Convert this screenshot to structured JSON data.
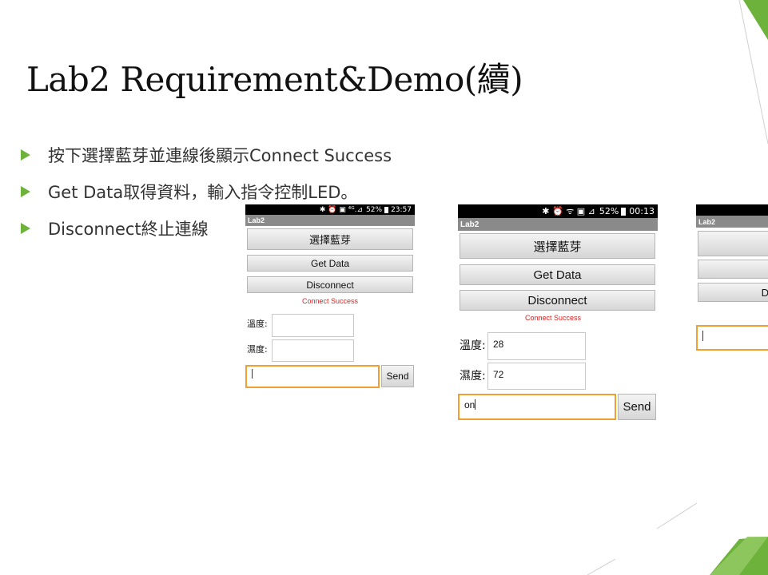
{
  "slide": {
    "title": "Lab2 Requirement&Demo(續)",
    "bullets": [
      "按下選擇藍芽並連線後顯示Connect Success",
      "Get Data取得資料，輸入指令控制LED。",
      "Disconnect終止連線"
    ]
  },
  "colors": {
    "accent": "#6db23a",
    "accent_dark": "#4e8f24",
    "status_red": "#e02020",
    "focus_orange": "#f0a030"
  },
  "phones": [
    {
      "status_icons": "✱ ⏰ ▣ ⁴ᴳ.⊿",
      "battery": "52%",
      "time": "23:57",
      "app_title": "Lab2",
      "select_bt_label": "選擇藍芽",
      "get_data_label": "Get Data",
      "disconnect_label": "Disconnect",
      "status_message": "Connect Success",
      "temp_label": "溫度:",
      "temp_value": "",
      "humidity_label": "濕度:",
      "humidity_value": "",
      "command_value": "",
      "send_label": "Send"
    },
    {
      "status_icons": "✱ ⏰ ᯤ ▣ ⊿",
      "battery": "52%",
      "time": "00:13",
      "app_title": "Lab2",
      "select_bt_label": "選擇藍芽",
      "get_data_label": "Get Data",
      "disconnect_label": "Disconnect",
      "status_message": "Connect Success",
      "temp_label": "溫度:",
      "temp_value": "28",
      "humidity_label": "濕度:",
      "humidity_value": "72",
      "command_value": "on",
      "send_label": "Send"
    },
    {
      "app_title": "Lab2",
      "disconnect_label_partial": "D"
    }
  ]
}
